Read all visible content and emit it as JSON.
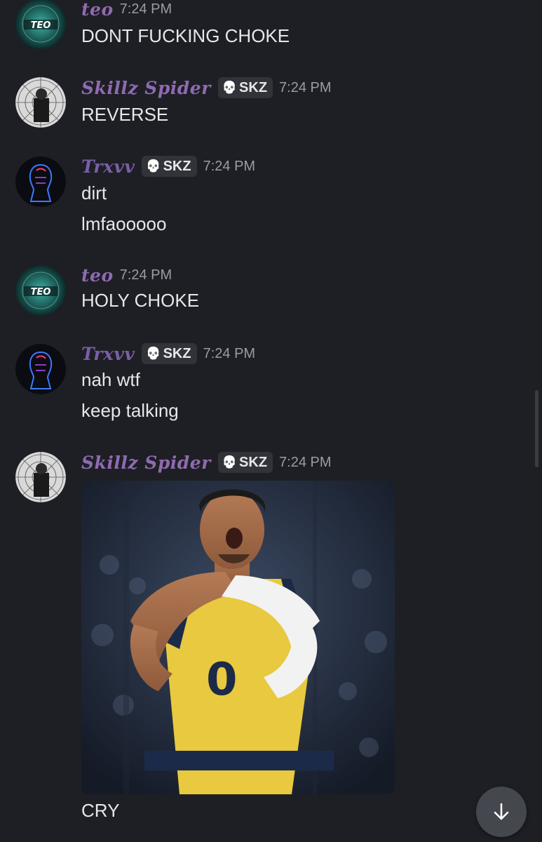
{
  "messages": [
    {
      "username": "teo",
      "time": "7:24 PM",
      "lines": [
        "DONT FUCKING CHOKE"
      ],
      "avatar_text": "TEO"
    },
    {
      "username": "Skillz Spider",
      "tag": "SKZ",
      "time": "7:24 PM",
      "lines": [
        "REVERSE"
      ]
    },
    {
      "username": "Trxvv",
      "tag": "SKZ",
      "time": "7:24 PM",
      "lines": [
        "dirt",
        "lmfaooooo"
      ]
    },
    {
      "username": "teo",
      "time": "7:24 PM",
      "lines": [
        "HOLY CHOKE"
      ],
      "avatar_text": "TEO"
    },
    {
      "username": "Trxvv",
      "tag": "SKZ",
      "time": "7:24 PM",
      "lines": [
        "nah wtf",
        "keep talking"
      ]
    },
    {
      "username": "Skillz Spider",
      "tag": "SKZ",
      "time": "7:24 PM",
      "lines": [
        "CRY"
      ],
      "jersey_number": "0",
      "has_image": true
    }
  ],
  "icons": {
    "tag_icon": "skull-icon",
    "scroll_button": "arrow-down-icon"
  },
  "colors": {
    "background": "#1e1f24",
    "teo_name": "#8f6ab1",
    "skillz_name": "#8f6ab1",
    "trxvv_name": "#7a5ea6",
    "tag_bg": "#313339",
    "timestamp": "#9a9ca3",
    "jersey": "#f2c94c"
  }
}
